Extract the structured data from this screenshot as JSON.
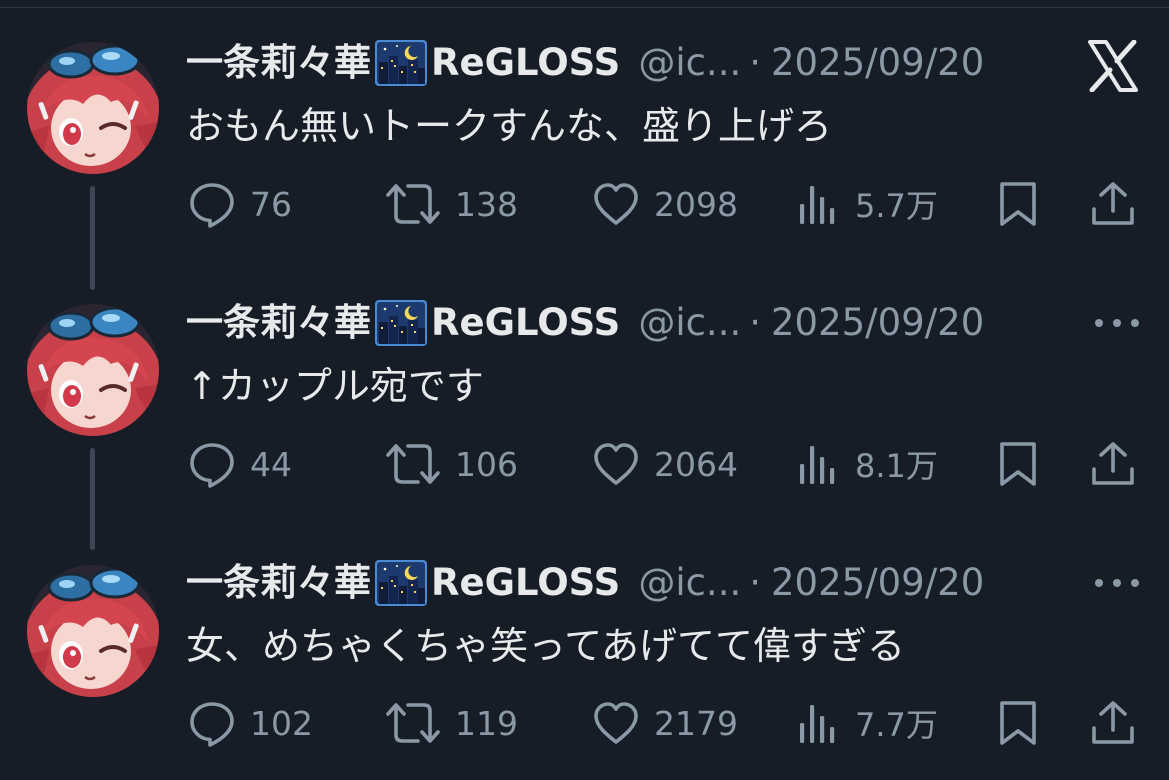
{
  "colors": {
    "background": "#161d27",
    "primary_text": "#e7e9ea",
    "secondary_text": "#8b98a5",
    "thread_line": "#3d4654"
  },
  "tweets": [
    {
      "name": "一条莉々華",
      "name_emoji": "night-city-emoji",
      "group": "ReGLOSS",
      "handle": "@ic...",
      "separator": "·",
      "date": "2025/09/20",
      "text": "おもん無いトークすんな、盛り上げろ",
      "corner_icon": "x-logo-icon",
      "replies": "76",
      "retweets": "138",
      "likes": "2098",
      "views": "5.7万"
    },
    {
      "name": "一条莉々華",
      "name_emoji": "night-city-emoji",
      "group": "ReGLOSS",
      "handle": "@ic...",
      "separator": "·",
      "date": "2025/09/20",
      "text": "↑カップル宛です",
      "corner_icon": "more-options-icon",
      "replies": "44",
      "retweets": "106",
      "likes": "2064",
      "views": "8.1万"
    },
    {
      "name": "一条莉々華",
      "name_emoji": "night-city-emoji",
      "group": "ReGLOSS",
      "handle": "@ic...",
      "separator": "·",
      "date": "2025/09/20",
      "text": "女、めちゃくちゃ笑ってあげてて偉すぎる",
      "corner_icon": "more-options-icon",
      "replies": "102",
      "retweets": "119",
      "likes": "2179",
      "views": "7.7万"
    }
  ]
}
